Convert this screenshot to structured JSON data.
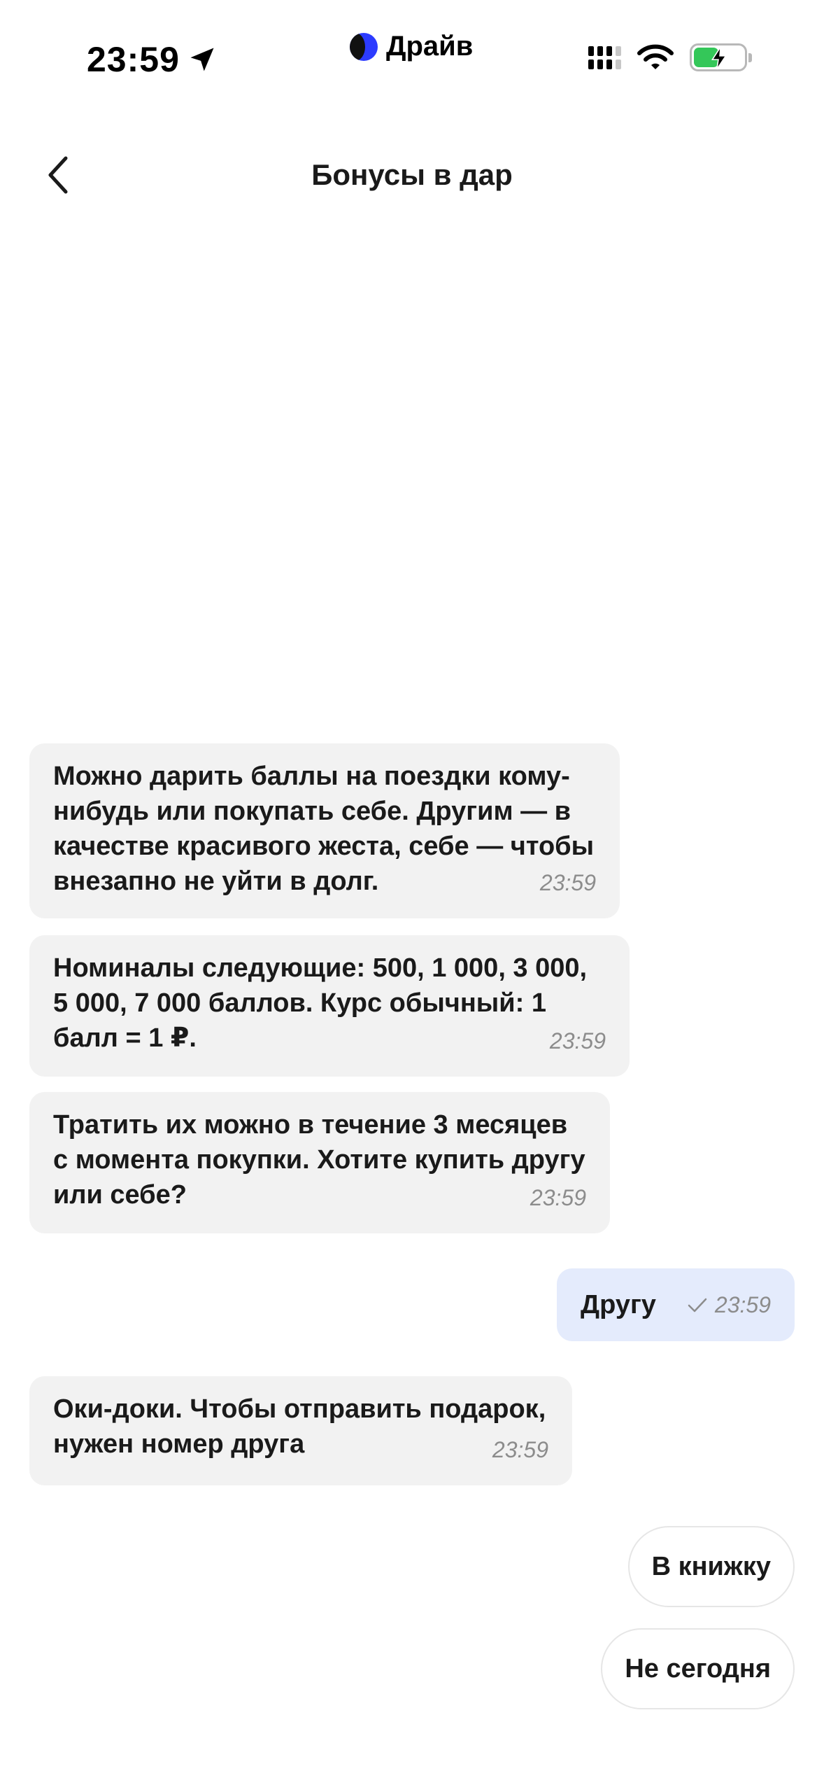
{
  "status_bar": {
    "time": "23:59",
    "carrier": "Драйв",
    "battery_level": 0.5,
    "location_icon": "location-arrow-icon",
    "signal_icon": "cellular-signal-icon",
    "wifi_icon": "wifi-icon",
    "battery_icon": "battery-charging-icon"
  },
  "header": {
    "title": "Бонусы в дар",
    "back_icon": "chevron-left-icon"
  },
  "messages": [
    {
      "from": "bot",
      "text": "Можно дарить баллы на поездки кому-нибудь или покупать себе. Другим — в качестве красивого жеста, себе — чтобы внезапно не уйти в долг.",
      "time": "23:59"
    },
    {
      "from": "bot",
      "text": "Номиналы следующие: 500, 1 000, 3 000, 5 000, 7 000 баллов. Курс обычный: 1 балл = 1 ₽.",
      "time": "23:59"
    },
    {
      "from": "bot",
      "text": "Тратить их можно в течение 3 месяцев с момента покупки. Хотите купить другу или себе?",
      "time": "23:59"
    },
    {
      "from": "user",
      "text": "Другу",
      "time": "23:59",
      "status_icon": "check-icon"
    },
    {
      "from": "bot",
      "text": "Оки-доки. Чтобы отправить подарок, нужен номер друга",
      "time": "23:59"
    }
  ],
  "quick_replies": [
    {
      "label": "В книжку"
    },
    {
      "label": "Не сегодня"
    }
  ],
  "colors": {
    "bot_bubble": "#f2f2f2",
    "user_bubble": "#e4ebfc",
    "time_text": "#8c8c8c",
    "carrier_logo": "#2c3bff",
    "battery_fill": "#34c759"
  }
}
